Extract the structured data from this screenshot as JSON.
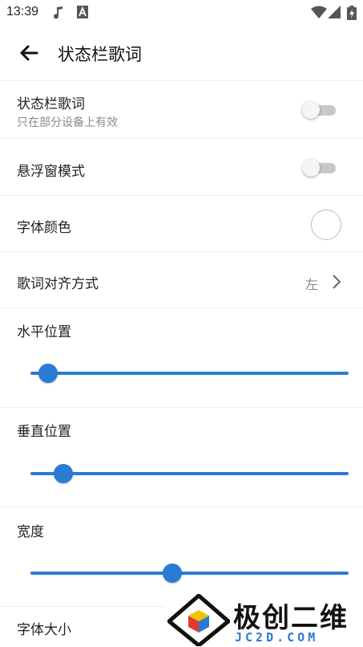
{
  "status_bar": {
    "time": "13:39",
    "left_icons": [
      "music-note-icon",
      "font-a-icon"
    ],
    "right_icons": [
      "wifi-icon",
      "signal-icon",
      "battery-icon"
    ]
  },
  "app_bar": {
    "back_icon": "arrow-back-icon",
    "title": "状态栏歌词"
  },
  "settings": {
    "statusbar_lyrics": {
      "label": "状态栏歌词",
      "subtitle": "只在部分设备上有效",
      "enabled": false
    },
    "floating_mode": {
      "label": "悬浮窗模式",
      "enabled": false
    },
    "font_color": {
      "label": "字体颜色",
      "color": "#ffffff"
    },
    "alignment": {
      "label": "歌词对齐方式",
      "value": "左"
    },
    "horizontal_position": {
      "label": "水平位置",
      "value_fraction": 0.055
    },
    "vertical_position": {
      "label": "垂直位置",
      "value_fraction": 0.103
    },
    "width": {
      "label": "宽度",
      "value_fraction": 0.445
    },
    "font_size": {
      "label": "字体大小"
    }
  },
  "watermark": {
    "title": "极创二维",
    "subtitle": "JC2D.COM"
  },
  "colors": {
    "accent": "#2a7bd3",
    "switch_off_track": "#c8c8c8",
    "divider": "#eeeeee"
  }
}
